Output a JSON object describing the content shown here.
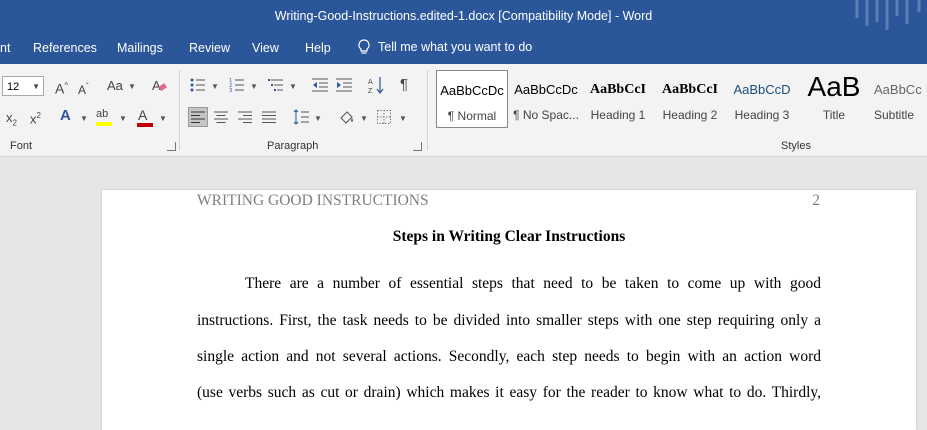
{
  "titlebar": {
    "title": "Writing-Good-Instructions.edited-1.docx [Compatibility Mode]  -  Word"
  },
  "tabs": [
    {
      "label": "nt"
    },
    {
      "label": "References"
    },
    {
      "label": "Mailings"
    },
    {
      "label": "Review"
    },
    {
      "label": "View"
    },
    {
      "label": "Help"
    }
  ],
  "tell_me": {
    "placeholder": "Tell me what you want to do",
    "icon": "lightbulb-icon"
  },
  "ribbon": {
    "font": {
      "size": "12",
      "group_label": "Font",
      "grow": "A",
      "shrink": "A",
      "change_case": "Aa",
      "subscript": "x",
      "superscript": "x",
      "text_effects": "A",
      "highlight": "ab",
      "font_color": "A",
      "font_color_hex": "#c00000",
      "highlight_hex": "#ffff00"
    },
    "paragraph": {
      "group_label": "Paragraph",
      "pilcrow": "¶"
    },
    "styles": {
      "group_label": "Styles",
      "items": [
        {
          "preview": "AaBbCcDc",
          "name": "¶ Normal",
          "selected": true
        },
        {
          "preview": "AaBbCcDc",
          "name": "¶ No Spac..."
        },
        {
          "preview": "AaBbCcI",
          "name": "Heading 1"
        },
        {
          "preview": "AaBbCcI",
          "name": "Heading 2"
        },
        {
          "preview": "AaBbCcD",
          "name": "Heading 3"
        },
        {
          "preview": "AaB",
          "name": "Title"
        },
        {
          "preview": "AaBbCc",
          "name": "Subtitle"
        }
      ]
    }
  },
  "document": {
    "running_header": "WRITING GOOD INSTRUCTIONS",
    "page_number": "2",
    "heading": "Steps in Writing Clear Instructions",
    "lines": [
      "There are a number of essential steps that need to be taken to come up with good",
      "instructions. First, the task needs to be divided into smaller steps with one step requiring only a",
      "single action and not several actions. Secondly, each step needs to begin with an action word",
      "(use verbs such as cut or drain) which makes it easy for the reader to know what to do. Thirdly,"
    ]
  }
}
